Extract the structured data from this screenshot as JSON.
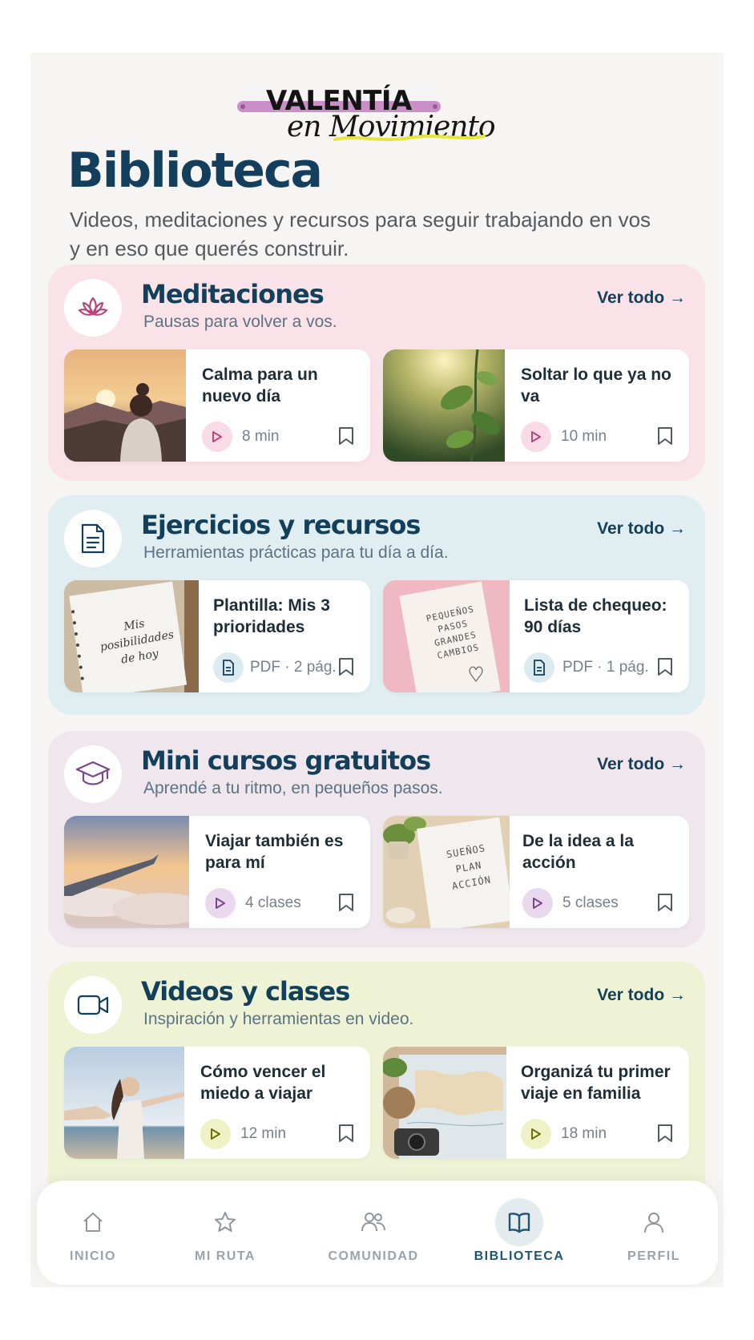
{
  "logo": {
    "line1": "VALENTÍA",
    "line2": "en Movimiento"
  },
  "page": {
    "title": "Biblioteca",
    "subtitle": "Videos, meditaciones y recursos para seguir trabajando en vos y en eso que querés construir."
  },
  "colors": {
    "primary": "#123f5a",
    "meditaciones_bg": "#f9e3e8",
    "ejercicios_bg": "#e0eef2",
    "cursos_bg": "#efe6ee",
    "videos_bg": "#eef3d6",
    "accent_pink": "#b8457e",
    "accent_purple": "#7d4790",
    "accent_olive": "#8a8b12"
  },
  "sections": [
    {
      "title": "Meditaciones",
      "subtitle": "Pausas para volver a vos.",
      "see_all": "Ver todo →",
      "icon": "lotus-icon",
      "cards": [
        {
          "title": "Calma para un nuevo día",
          "meta": "8 min",
          "meta_icon": "play-icon",
          "image": "woman-sunrise-mountains"
        },
        {
          "title": "Soltar lo que ya no va",
          "meta": "10 min",
          "meta_icon": "play-icon",
          "image": "leaves-sunlight"
        }
      ]
    },
    {
      "title": "Ejercicios y recursos",
      "subtitle": "Herramientas prácticas para tu día a día.",
      "see_all": "Ver todo →",
      "icon": "document-icon",
      "cards": [
        {
          "title": "Plantilla: Mis 3 prioridades",
          "meta": "PDF · 2 pág.",
          "meta_icon": "document-icon",
          "image": "notebook",
          "image_text": [
            "Mis",
            "posibilidades",
            "de hoy"
          ]
        },
        {
          "title": "Lista de chequeo: 90 días",
          "meta": "PDF · 1 pág.",
          "meta_icon": "document-icon",
          "image": "notebook-pink",
          "image_text": [
            "PEQUEÑOS",
            "PASOS",
            "GRANDES",
            "CAMBIOS"
          ]
        }
      ]
    },
    {
      "title": "Mini cursos gratuitos",
      "subtitle": "Aprendé a tu ritmo, en pequeños pasos.",
      "see_all": "Ver todo →",
      "icon": "graduation-cap-icon",
      "cards": [
        {
          "title": "Viajar también es para mí",
          "meta": "4 clases",
          "meta_icon": "play-icon",
          "image": "airplane-wing-clouds"
        },
        {
          "title": "De la idea a la acción",
          "meta": "5 clases",
          "meta_icon": "play-icon",
          "image": "notebook-plant",
          "image_text": [
            "SUEÑOS",
            "PLAN",
            "ACCIÓN"
          ]
        }
      ]
    },
    {
      "title": "Videos y clases",
      "subtitle": "Inspiración y herramientas en video.",
      "see_all": "Ver todo →",
      "icon": "video-camera-icon",
      "cards": [
        {
          "title": "Cómo vencer el miedo a viajar",
          "meta": "12 min",
          "meta_icon": "play-icon",
          "image": "woman-beach"
        },
        {
          "title": "Organizá tu primer viaje en familia",
          "meta": "18 min",
          "meta_icon": "play-icon",
          "image": "map-camera"
        }
      ]
    }
  ],
  "nav": [
    {
      "label": "INICIO",
      "icon": "home-icon",
      "active": false
    },
    {
      "label": "MI RUTA",
      "icon": "star-icon",
      "active": false
    },
    {
      "label": "COMUNIDAD",
      "icon": "people-icon",
      "active": false
    },
    {
      "label": "BIBLIOTECA",
      "icon": "book-icon",
      "active": true
    },
    {
      "label": "PERFIL",
      "icon": "person-icon",
      "active": false
    }
  ]
}
